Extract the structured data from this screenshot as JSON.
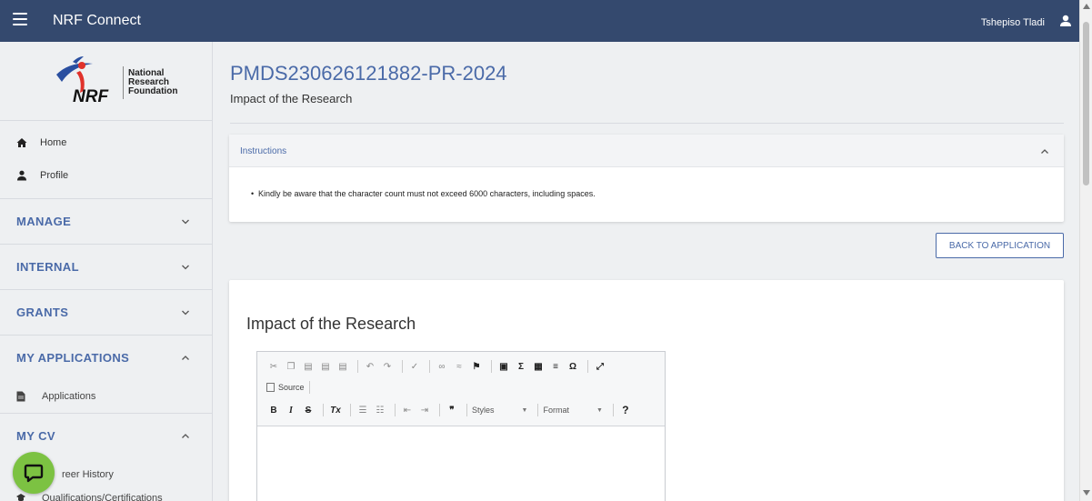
{
  "topbar": {
    "app_title": "NRF Connect",
    "user_name": "Tshepiso Tladi"
  },
  "logo": {
    "text_line1": "National",
    "text_line2": "Research",
    "text_line3": "Foundation",
    "mark_text": "NRF"
  },
  "sidebar": {
    "home_label": "Home",
    "profile_label": "Profile",
    "sections": [
      {
        "label": "MANAGE",
        "expanded": false
      },
      {
        "label": "INTERNAL",
        "expanded": false
      },
      {
        "label": "GRANTS",
        "expanded": false
      },
      {
        "label": "MY APPLICATIONS",
        "expanded": true
      },
      {
        "label": "MY CV",
        "expanded": true
      }
    ],
    "applications_label": "Applications",
    "career_history_label": "reer History",
    "qualifications_label": "Qualifications/Certifications"
  },
  "main": {
    "title": "PMDS230626121882-PR-2024",
    "subtitle": "Impact of the Research",
    "instructions_label": "Instructions",
    "instructions_text": "Kindly be aware that the character count must not exceed 6000 characters, including spaces.",
    "back_button": "BACK TO APPLICATION",
    "editor_heading": "Impact of the Research"
  },
  "editor_toolbar": {
    "source_label": "Source",
    "styles_label": "Styles",
    "format_label": "Format",
    "help_label": "?"
  },
  "colors": {
    "topbar": "#34496e",
    "accent": "#4a6aa8",
    "chat": "#7cc242"
  }
}
